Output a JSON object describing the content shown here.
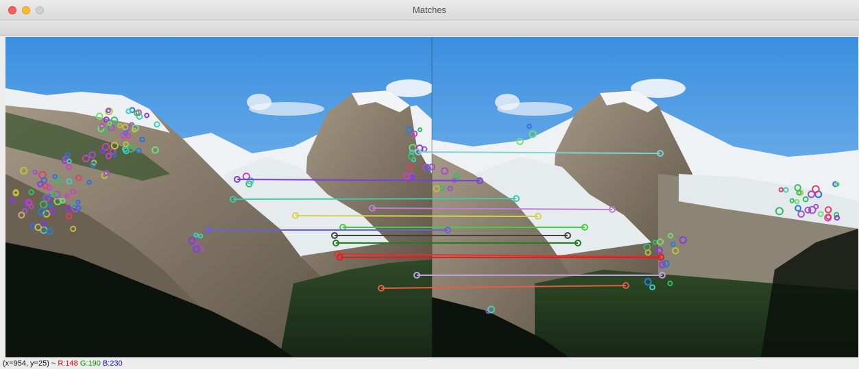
{
  "window": {
    "title": "Matches"
  },
  "status": {
    "coords": "(x=954, y=25) ~",
    "r": "R:148",
    "g": "G:190",
    "b": "B:230"
  },
  "colors": {
    "sky_top": "#3b8fe0",
    "sky_bottom": "#a8d2f2",
    "snow": "#f2f4f6",
    "rock": "#8a7d6a",
    "forest": "#1f3a1c",
    "shadow": "#0c120c"
  },
  "matches": [
    {
      "color": "#7fd6d0"
    },
    {
      "color": "#7a3fe0"
    },
    {
      "color": "#3fc9a8"
    },
    {
      "color": "#c080d0"
    },
    {
      "color": "#d8d050"
    },
    {
      "color": "#40d040"
    },
    {
      "color": "#6a60e0"
    },
    {
      "color": "#404040"
    },
    {
      "color": "#208020"
    },
    {
      "color": "#e03030"
    },
    {
      "color": "#e02020"
    },
    {
      "color": "#c0a0e0"
    },
    {
      "color": "#e06040"
    }
  ],
  "keypoint_palette": [
    "#8a3ae0",
    "#30c060",
    "#d040c0",
    "#3070e0",
    "#40d0c0",
    "#e04060",
    "#70e070",
    "#a050d0",
    "#2080e0",
    "#c0c040"
  ]
}
